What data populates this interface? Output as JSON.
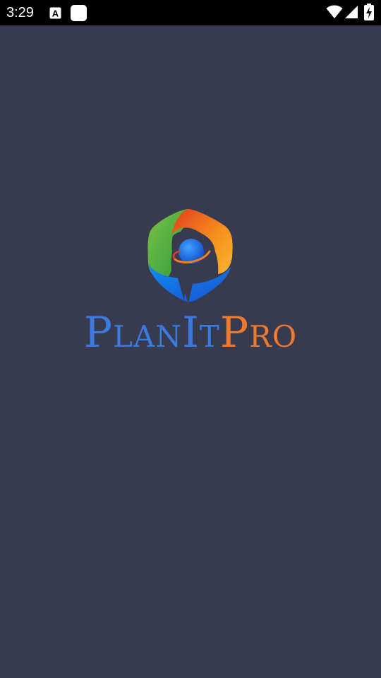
{
  "status_bar": {
    "time": "3:29",
    "icons": [
      "font-notification-icon",
      "app-notification-icon",
      "wifi-icon",
      "cellular-signal-icon",
      "battery-charging-icon"
    ]
  },
  "splash": {
    "logo_icon": "planitpro-logo-icon",
    "wordmark_part_1": "PlanIt",
    "wordmark_part_2": "Pro",
    "colors": {
      "background": "#383b50",
      "wordmark_blue": "#3b7be0",
      "wordmark_orange": "#ee7a2f",
      "logo_green": "#3fae49",
      "logo_orange": "#f47e20",
      "logo_blue": "#1f6fdc"
    }
  }
}
